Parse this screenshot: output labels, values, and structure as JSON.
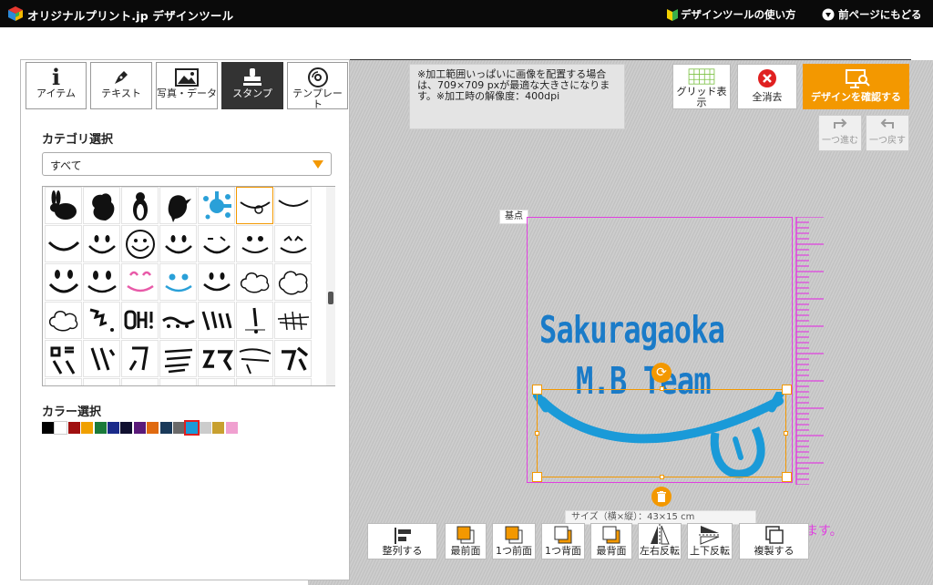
{
  "header": {
    "site_name": "オリジナルプリント.jp デザインツール",
    "howto_label": "デザインツールの使い方",
    "back_label": "前ページにもどる"
  },
  "tabs": [
    {
      "label": "アイテム",
      "icon": "info-icon"
    },
    {
      "label": "テキスト",
      "icon": "pen-icon"
    },
    {
      "label": "写真・データ",
      "icon": "image-icon"
    },
    {
      "label": "スタンプ",
      "icon": "stamp-icon",
      "active": true
    },
    {
      "label": "テンプレート",
      "icon": "disc-icon"
    }
  ],
  "category": {
    "label": "カテゴリ選択",
    "selected": "すべて"
  },
  "color": {
    "label": "カラー選択",
    "swatches": [
      "#000000",
      "#ffffff",
      "#a01010",
      "#f0a000",
      "#1a7a3a",
      "#1a2a8a",
      "#101030",
      "#5a1a7a",
      "#e06a10",
      "#1a3a5a",
      "#6a6a6a",
      "#1a9ad8",
      "#cccccc",
      "#c8a030",
      "#f0a0d0"
    ]
  },
  "info": {
    "text": "※加工範囲いっぱいに画像を配置する場合は、709×709 pxが最適な大きさになります。※加工時の解像度：400dpi"
  },
  "top_buttons": {
    "grid": "グリッド表示",
    "clear": "全消去",
    "confirm": "デザインを確認する",
    "redo": "一つ進む",
    "undo": "一つ戻す"
  },
  "canvas": {
    "baseline_label": "基点",
    "logo_line1": "Sakuragaoka",
    "logo_line2": "M.B Team",
    "size_tip": "サイズ（横×縦）：43×15 cm",
    "note": "ます。",
    "accent_color": "#f39800",
    "print_area_color": "#e040e0",
    "logo_color": "#1a7bc8"
  },
  "bottom_toolbar": {
    "align": "整列する",
    "front": "最前面",
    "forward": "1つ前面",
    "backward": "1つ背面",
    "back": "最背面",
    "flip_h": "左右反転",
    "flip_v": "上下反転",
    "duplicate": "複製する"
  }
}
